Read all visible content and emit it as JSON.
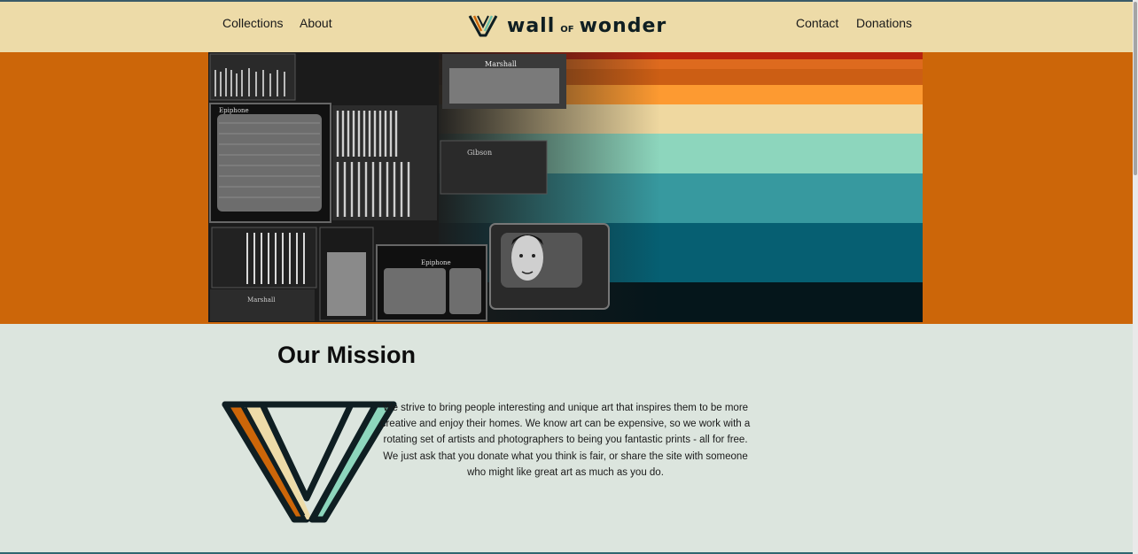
{
  "nav": {
    "collections": "Collections",
    "about": "About",
    "contact": "Contact",
    "donations": "Donations"
  },
  "brand": {
    "wall": "wall",
    "of": "OF",
    "wonder": "wonder"
  },
  "hero": {
    "amp_label_1": "Marshall",
    "amp_label_2": "Epiphone",
    "amp_label_3": "Gibson",
    "amp_label_4": "Epiphone",
    "amp_label_5": "Marshall"
  },
  "mission": {
    "title": "Our Mission",
    "body": "We strive to bring people interesting and unique art that inspires them to be more creative and enjoy their homes. We know art can be expensive, so we work with a rotating set of artists and photographers to being you fantastic prints - all for free. We just ask that you donate what you think is fair, or share the site with someone who might like great art as much as you do."
  },
  "colors": {
    "header_bg": "#eddba8",
    "banner_bg": "#cc6609",
    "page_bg": "#dce5de",
    "stripe_red": "#b8220d",
    "stripe_orange": "#de6a1e",
    "stripe_amber": "#fd9a31",
    "stripe_cream": "#efd8a0",
    "stripe_mint": "#8dd6bd",
    "stripe_teal": "#37999f",
    "stripe_deepteal": "#065f72",
    "stripe_black": "#05161b"
  }
}
